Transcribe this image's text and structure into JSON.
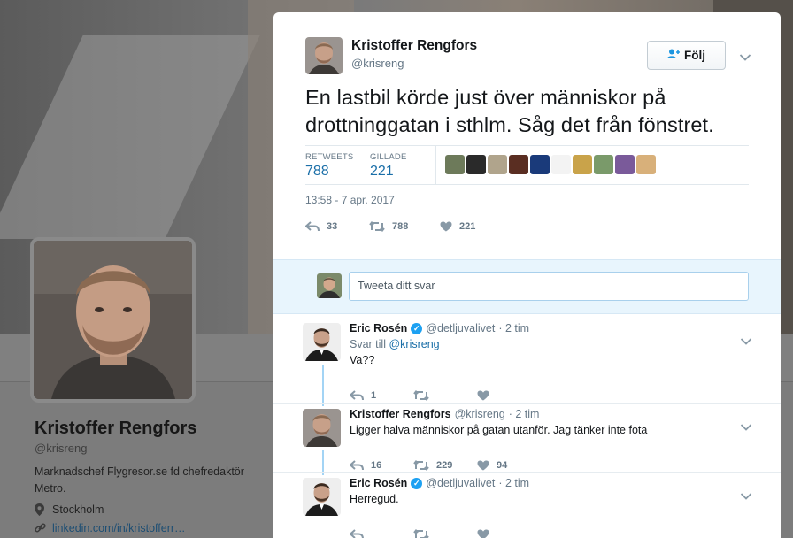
{
  "profile": {
    "name": "Kristoffer Rengfors",
    "handle": "@krisreng",
    "bio": "Marknadschef Flygresor.se fd chefredaktör Metro.",
    "location": "Stockholm",
    "link": "linkedin.com/in/kristofferr…"
  },
  "tweet": {
    "author_name": "Kristoffer Rengfors",
    "author_handle": "@krisreng",
    "follow_label": "Följ",
    "text": "En lastbil körde just över människor på drottninggatan i sthlm. Såg det från fönstret.",
    "retweets_label": "RETWEETS",
    "retweets": "788",
    "likes_label": "GILLADE",
    "likes": "221",
    "timestamp": "13:58 - 7 apr. 2017",
    "actions": {
      "reply_count": "33",
      "retweet_count": "788",
      "like_count": "221"
    },
    "liker_colors": [
      "#6d7a5a",
      "#2a2a2a",
      "#b0a48c",
      "#5a2e22",
      "#1a3a7a",
      "#f3f3f3",
      "#c9a34a",
      "#7a9a6a",
      "#7a5a9a",
      "#d8b07a"
    ]
  },
  "reply_box": {
    "placeholder": "Tweeta ditt svar"
  },
  "replies": [
    {
      "name": "Eric Rosén",
      "handle": "@detljuvalivet",
      "time": "· 2 tim",
      "reply_to_prefix": "Svar till",
      "reply_to": "@krisreng",
      "text": "Va??",
      "reply_count": "1",
      "retweet_count": "",
      "like_count": ""
    },
    {
      "name": "Kristoffer Rengfors",
      "handle": "@krisreng",
      "time": "· 2 tim",
      "text": "Ligger halva människor på gatan utanför. Jag tänker inte fota",
      "reply_count": "16",
      "retweet_count": "229",
      "like_count": "94"
    },
    {
      "name": "Eric Rosén",
      "handle": "@detljuvalivet",
      "time": "· 2 tim",
      "text": "Herregud.",
      "reply_count": "",
      "retweet_count": "",
      "like_count": ""
    }
  ],
  "colors": {
    "accent": "#1da1f2",
    "link": "#1b6fa8",
    "muted": "#657786"
  }
}
